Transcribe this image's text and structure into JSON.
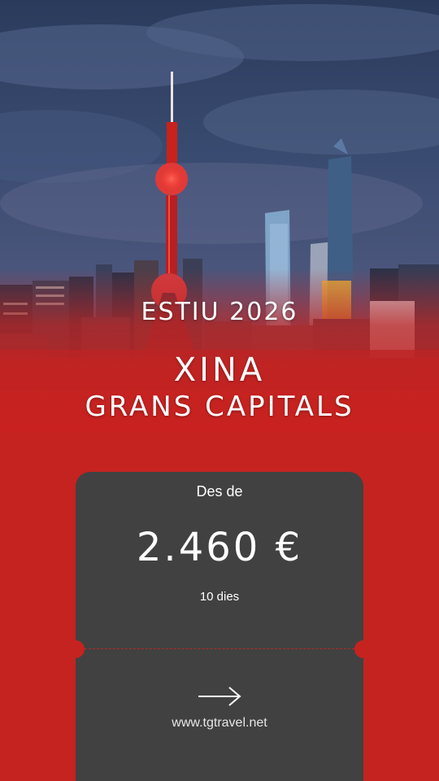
{
  "hero": {
    "season": "ESTIU 2026",
    "destination": "XINA",
    "subtitle": "GRANS CAPITALS"
  },
  "ticket": {
    "from_label": "Des de",
    "price": "2.460 €",
    "duration": "10 dies",
    "arrow_icon": "arrow-right-icon",
    "website": "www.tgtravel.net"
  },
  "colors": {
    "brand_red": "#c9211f",
    "ticket_gray": "#414141",
    "night_sky": "#2d3a57"
  }
}
